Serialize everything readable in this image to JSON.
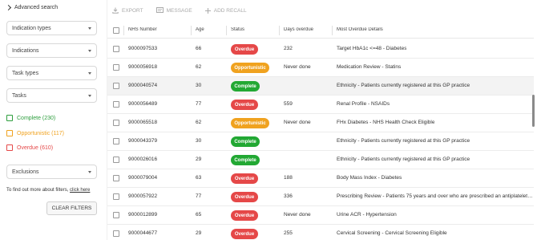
{
  "sidebar": {
    "advanced_search": "Advanced search",
    "selects": [
      "Indication types",
      "Indications",
      "Task types",
      "Tasks"
    ],
    "filters": [
      {
        "label": "Complete (230)",
        "color": "#2e9e3e"
      },
      {
        "label": "Opportunistic (117)",
        "color": "#f0a21f"
      },
      {
        "label": "Overdue (610)",
        "color": "#e54848"
      }
    ],
    "exclusions": "Exclusions",
    "find_text": "To find out more about filters,",
    "find_link": "click here",
    "clear_filters": "CLEAR FILTERS"
  },
  "toolbar": {
    "export": "EXPORT",
    "message": "MESSAGE",
    "add_recall": "ADD RECALL"
  },
  "table": {
    "headers": [
      "NHS Number",
      "Age",
      "Status",
      "Days overdue",
      "Most Overdue Details"
    ],
    "rows": [
      {
        "nhs": "9000097533",
        "age": "66",
        "status": "Overdue",
        "days": "232",
        "details": "Target HbA1c <=48 - Diabetes"
      },
      {
        "nhs": "9000056918",
        "age": "62",
        "status": "Opportunistic",
        "days": "Never done",
        "details": "Medication Review - Statins"
      },
      {
        "nhs": "9000040574",
        "age": "30",
        "status": "Complete",
        "days": "",
        "details": "Ethnicity - Patients currently registered at this GP practice"
      },
      {
        "nhs": "9000056489",
        "age": "77",
        "status": "Overdue",
        "days": "559",
        "details": "Renal Profile - NSAIDs"
      },
      {
        "nhs": "9000065518",
        "age": "62",
        "status": "Opportunistic",
        "days": "Never done",
        "details": "FHx Diabetes - NHS Health Check Eligible"
      },
      {
        "nhs": "9000043379",
        "age": "30",
        "status": "Complete",
        "days": "",
        "details": "Ethnicity - Patients currently registered at this GP practice"
      },
      {
        "nhs": "9000026016",
        "age": "29",
        "status": "Complete",
        "days": "",
        "details": "Ethnicity - Patients currently registered at this GP practice"
      },
      {
        "nhs": "9000079004",
        "age": "63",
        "status": "Overdue",
        "days": "188",
        "details": "Body Mass Index - Diabetes"
      },
      {
        "nhs": "9000057922",
        "age": "77",
        "status": "Overdue",
        "days": "336",
        "details": "Prescribing Review - Patients 75 years and over who are prescribed an antiplatelet wit..."
      },
      {
        "nhs": "9000012899",
        "age": "65",
        "status": "Overdue",
        "days": "Never done",
        "details": "Urine ACR - Hypertension"
      },
      {
        "nhs": "9000044677",
        "age": "29",
        "status": "Overdue",
        "days": "255",
        "details": "Cervical Screening - Cervical Screening Eligible"
      }
    ]
  },
  "status_colors": {
    "Overdue": "#e54848",
    "Opportunistic": "#f0a21f",
    "Complete": "#22a833"
  }
}
